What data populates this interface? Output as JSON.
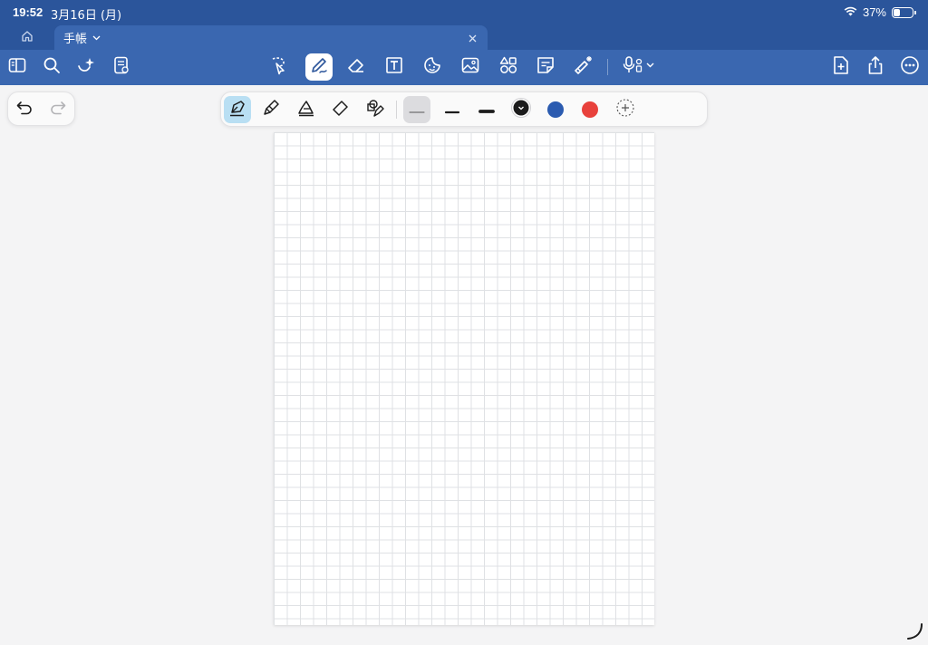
{
  "status_bar": {
    "time": "19:52",
    "date": "3月16日 (月)",
    "battery_text": "37%",
    "battery_level": 0.37
  },
  "tabs": {
    "home_icon": "home-icon",
    "document_title": "手帳"
  },
  "toolbar": {
    "left_icons": [
      "sidebar-icon",
      "search-icon",
      "sparkle-icon",
      "notebook-icon"
    ],
    "center_tools": [
      "lasso-icon",
      "pen-icon",
      "eraser-icon",
      "textbox-icon",
      "sticker-icon",
      "image-icon",
      "shapes-icon",
      "sticky-note-icon",
      "laser-pointer-icon",
      "microphone-icon"
    ],
    "active_tool": "pen",
    "right_icons": [
      "add-page-icon",
      "share-icon",
      "more-icon"
    ]
  },
  "pen_options": {
    "tools": [
      "fountain-pen",
      "ballpoint-pen",
      "brush-pen",
      "highlighter",
      "shape-pen"
    ],
    "selected_tool": "fountain-pen",
    "widths": [
      "thin",
      "medium",
      "thick"
    ],
    "selected_width": "thin",
    "colors": [
      "#1c1c1c",
      "#2b5bb0",
      "#e8413c"
    ],
    "selected_color": "#1c1c1c"
  },
  "colors": {
    "header_bg": "#2b559b",
    "toolbar_bg": "#3a67b0",
    "canvas_bg": "#f4f4f5",
    "grid_line": "#dfe1e4"
  }
}
